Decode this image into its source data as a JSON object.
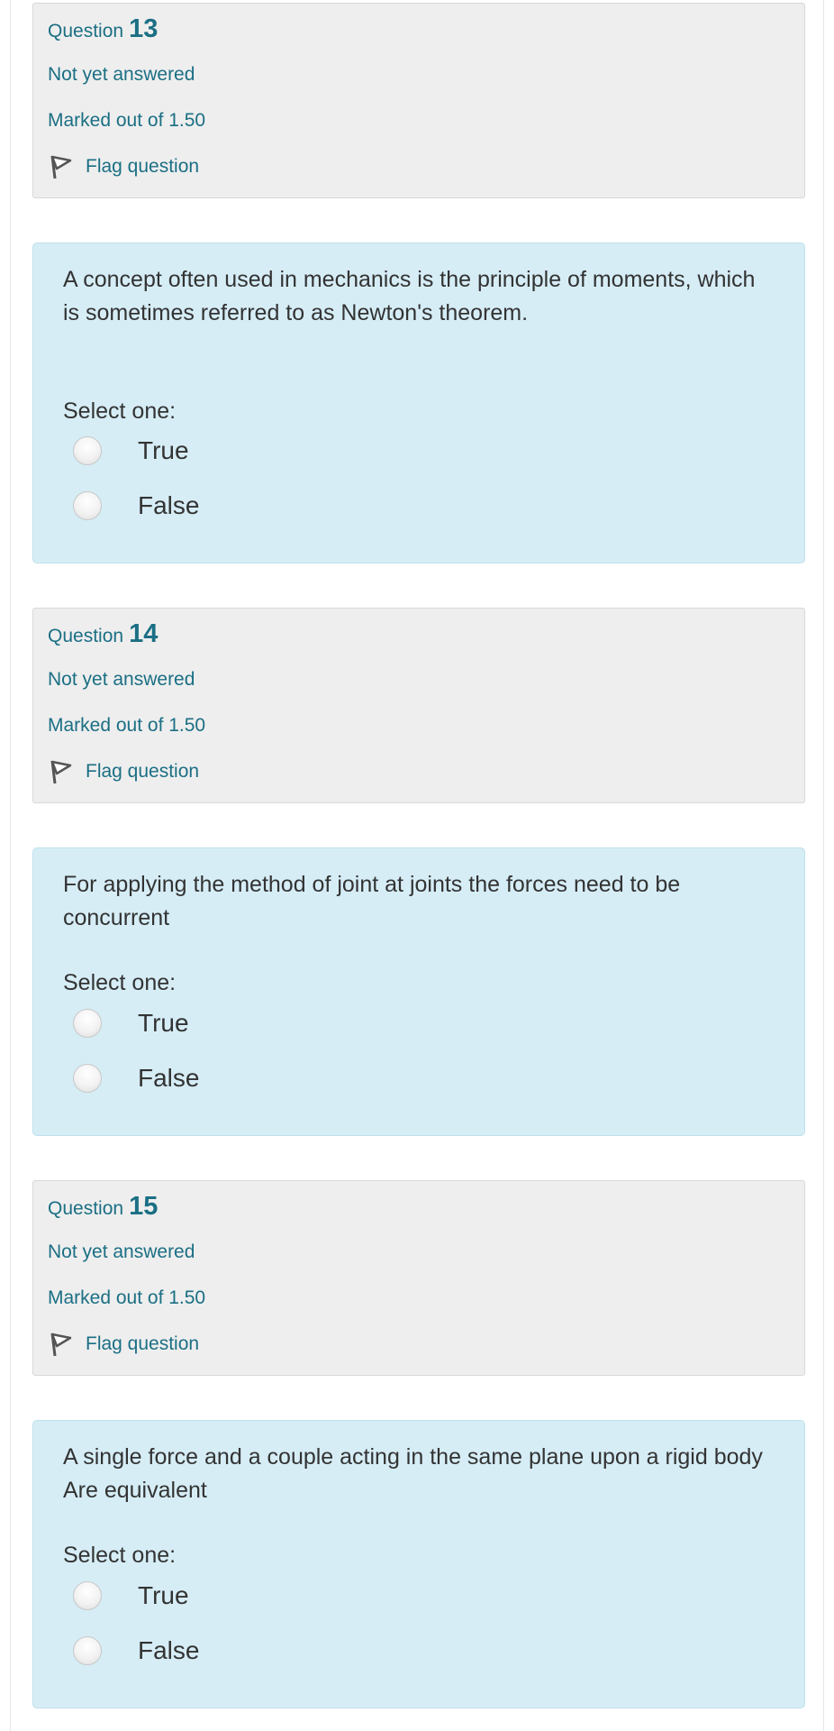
{
  "questions": [
    {
      "label": "Question",
      "number": "13",
      "state": "Not yet answered",
      "grade": "Marked out of 1.50",
      "flag": "Flag question",
      "text": "A concept often used in mechanics is the principle of moments, which is sometimes referred to as Newton's theorem.",
      "prompt": "Select one:",
      "options": [
        "True",
        "False"
      ]
    },
    {
      "label": "Question",
      "number": "14",
      "state": "Not yet answered",
      "grade": "Marked out of 1.50",
      "flag": "Flag question",
      "text": "For applying the method of joint at joints the forces need to be concurrent",
      "prompt": "Select one:",
      "options": [
        "True",
        "False"
      ]
    },
    {
      "label": "Question",
      "number": "15",
      "state": "Not yet answered",
      "grade": "Marked out of 1.50",
      "flag": "Flag question",
      "text": "A single force and a couple acting in the same plane upon a rigid body  Are equivalent",
      "prompt": "Select one:",
      "options": [
        "True",
        "False"
      ]
    }
  ],
  "colors": {
    "info_bg": "#eeeeee",
    "content_bg": "#d6edf6",
    "link": "#1b6f84",
    "text": "#333333"
  },
  "icons": {
    "flag": "flag-icon",
    "radio": "radio-unchecked-icon"
  }
}
